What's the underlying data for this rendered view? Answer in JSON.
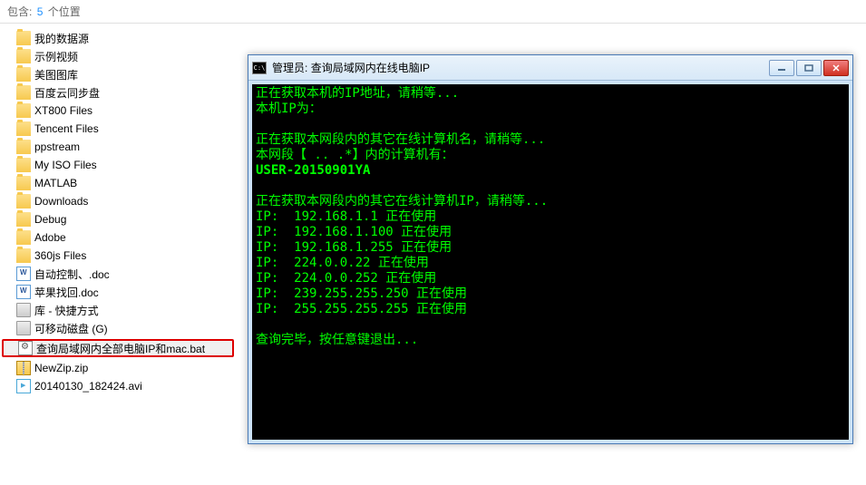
{
  "header": {
    "prefix": "包含:",
    "count": "5",
    "suffix": "个位置"
  },
  "files": [
    {
      "label": "我的数据源",
      "icon": "folder"
    },
    {
      "label": "示例视频",
      "icon": "folder"
    },
    {
      "label": "美图图库",
      "icon": "folder"
    },
    {
      "label": "百度云同步盘",
      "icon": "folder"
    },
    {
      "label": "XT800 Files",
      "icon": "folder"
    },
    {
      "label": "Tencent Files",
      "icon": "folder"
    },
    {
      "label": "ppstream",
      "icon": "folder"
    },
    {
      "label": "My ISO Files",
      "icon": "folder"
    },
    {
      "label": "MATLAB",
      "icon": "folder"
    },
    {
      "label": "Downloads",
      "icon": "folder"
    },
    {
      "label": "Debug",
      "icon": "folder"
    },
    {
      "label": "Adobe",
      "icon": "folder"
    },
    {
      "label": "360js Files",
      "icon": "folder"
    },
    {
      "label": "自动控制、.doc",
      "icon": "doc"
    },
    {
      "label": "苹果找回.doc",
      "icon": "doc"
    },
    {
      "label": "库 - 快捷方式",
      "icon": "drive"
    },
    {
      "label": "可移动磁盘 (G)",
      "icon": "drive"
    },
    {
      "label": "查询局域网内全部电脑IP和mac.bat",
      "icon": "bat",
      "highlighted": true
    },
    {
      "label": "NewZip.zip",
      "icon": "zip"
    },
    {
      "label": "20140130_182424.avi",
      "icon": "video"
    }
  ],
  "console": {
    "title_prefix": "管理员:",
    "title": "查询局域网内在线电脑IP",
    "icon_text": "C:\\",
    "lines": [
      "正在获取本机的IP地址，请稍等...",
      "本机IP为：",
      "",
      "正在获取本网段内的其它在线计算机名，请稍等...",
      "本网段【 .. .*】内的计算机有：",
      "USER-20150901YA",
      "",
      "正在获取本网段内的其它在线计算机IP，请稍等...",
      "IP:  192.168.1.1 正在使用",
      "IP:  192.168.1.100 正在使用",
      "IP:  192.168.1.255 正在使用",
      "IP:  224.0.0.22 正在使用",
      "IP:  224.0.0.252 正在使用",
      "IP:  239.255.255.250 正在使用",
      "IP:  255.255.255.255 正在使用",
      "",
      "查询完毕，按任意键退出..."
    ]
  }
}
